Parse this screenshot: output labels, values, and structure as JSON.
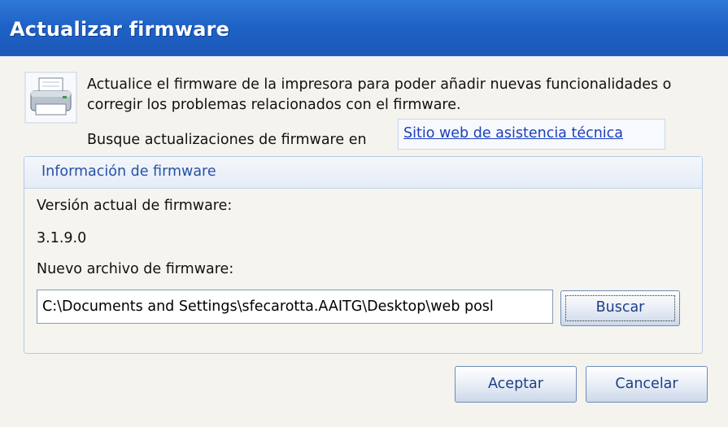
{
  "window": {
    "title": "Actualizar firmware"
  },
  "header": {
    "icon": "printer-icon",
    "description": "Actualice el firmware de la impresora para poder añadir nuevas funcionalidades o corregir los problemas relacionados con el firmware.",
    "search_label": "Busque actualizaciones de firmware en",
    "support_link": "Sitio web de asistencia técnica"
  },
  "firmware_info": {
    "group_title": "Información de firmware",
    "current_version_label": "Versión actual de firmware:",
    "current_version_value": "3.1.9.0",
    "new_file_label": "Nuevo archivo de firmware:",
    "new_file_value": "C:\\Documents and Settings\\sfecarotta.AAITG\\Desktop\\web posl",
    "browse_button": "Buscar"
  },
  "footer": {
    "ok_button": "Aceptar",
    "cancel_button": "Cancelar"
  },
  "colors": {
    "titlebar": "#1f62c6",
    "link": "#1a3fbf",
    "group_title": "#2651a6",
    "background": "#f4f3ee"
  }
}
